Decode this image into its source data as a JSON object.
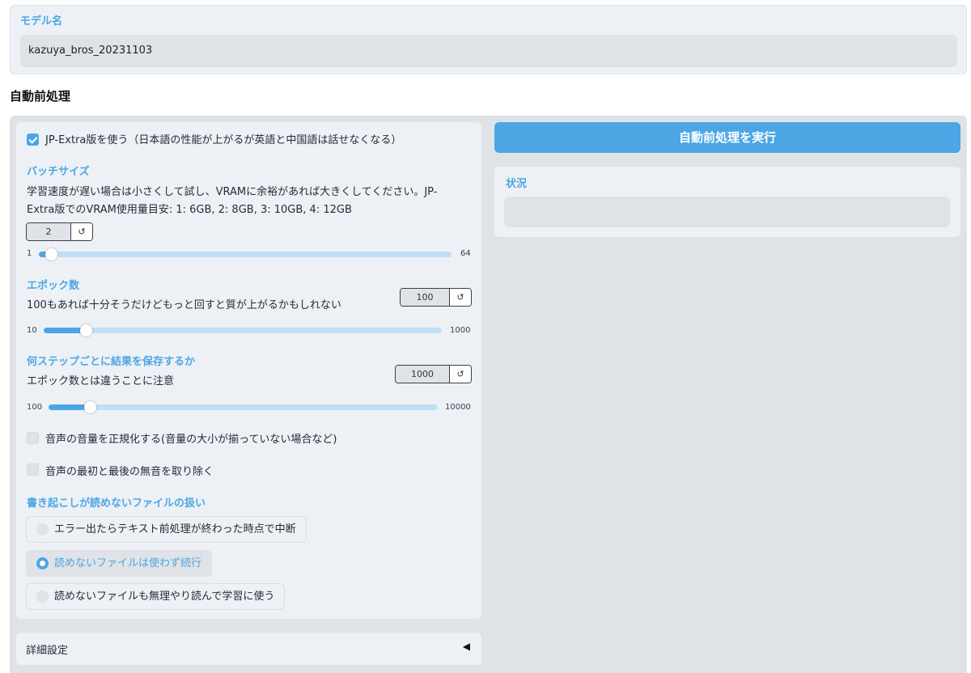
{
  "model": {
    "label": "モデル名",
    "value": "kazuya_bros_20231103"
  },
  "section_title": "自動前処理",
  "jp_extra": {
    "label": "JP-Extra版を使う（日本語の性能が上がるが英語と中国語は話せなくなる）",
    "checked": true
  },
  "batch_size": {
    "label": "バッチサイズ",
    "desc_line1": "学習速度が遅い場合は小さくして試し、VRAMに余裕があれば大きくしてください。JP-",
    "desc_line2": "Extra版でのVRAM使用量目安: 1: 6GB, 2: 8GB, 3: 10GB, 4: 12GB",
    "value": "2",
    "min": "1",
    "max": "64",
    "fraction": 0.016
  },
  "epochs": {
    "label": "エポック数",
    "desc": "100もあれば十分そうだけどもっと回すと質が上がるかもしれない",
    "value": "100",
    "min": "10",
    "max": "1000",
    "fraction": 0.091
  },
  "save_every": {
    "label": "何ステップごとに結果を保存するか",
    "desc": "エポック数とは違うことに注意",
    "value": "1000",
    "min": "100",
    "max": "10000",
    "fraction": 0.091
  },
  "reset_icon": "↺",
  "normalize": {
    "label": "音声の音量を正規化する(音量の大小が揃っていない場合など)",
    "checked": false
  },
  "trim": {
    "label": "音声の最初と最後の無音を取り除く",
    "checked": false
  },
  "unreadable": {
    "label": "書き起こしが読めないファイルの扱い",
    "options": [
      "エラー出たらテキスト前処理が終わった時点で中断",
      "読めないファイルは使わず続行",
      "読めないファイルも無理やり読んで学習に使う"
    ],
    "selected_index": 1
  },
  "details": {
    "label": "詳細設定",
    "arrow": "◀"
  },
  "run_button": "自動前処理を実行",
  "status": {
    "label": "状況",
    "value": ""
  },
  "colors": {
    "accent": "#4ca6e4",
    "track": "#bfdff6",
    "card": "#edf1f5",
    "panel": "#dfe3e7"
  }
}
